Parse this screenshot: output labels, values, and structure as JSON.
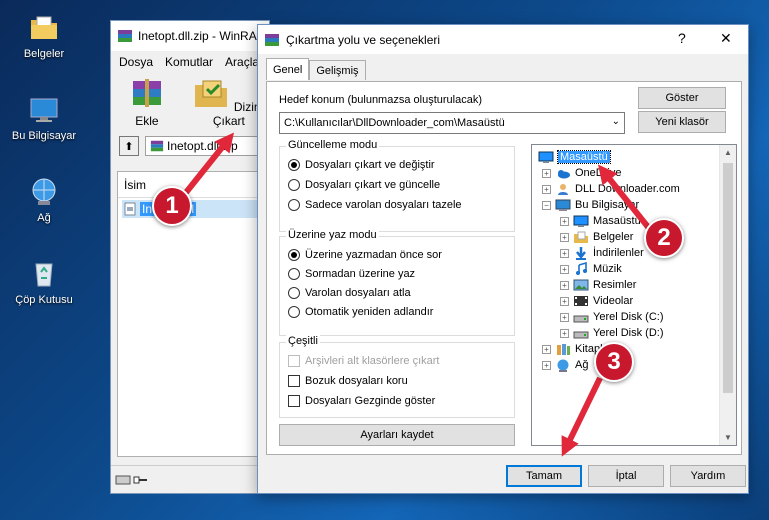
{
  "desktop": {
    "icons": [
      {
        "label": "Belgeler",
        "icon": "folder-documents-icon"
      },
      {
        "label": "Bu Bilgisayar",
        "icon": "computer-icon"
      },
      {
        "label": "Ağ",
        "icon": "network-icon"
      },
      {
        "label": "Çöp Kutusu",
        "icon": "recycle-bin-icon"
      }
    ]
  },
  "winrar": {
    "title": "Inetopt.dll.zip - WinRAR",
    "menu": [
      "Dosya",
      "Komutlar",
      "Araçlar"
    ],
    "tools": [
      {
        "label": "Ekle",
        "icon": "add-archive-icon"
      },
      {
        "label": "Dizine Çıkart",
        "icon": "extract-to-icon"
      }
    ],
    "address": "Inetopt.dll.zip",
    "column_header": "İsim",
    "selected_item": "Inetopt.dll"
  },
  "dialog": {
    "title": "Çıkartma yolu ve seçenekleri",
    "help_symbol": "?",
    "close_symbol": "✕",
    "tabs": [
      "Genel",
      "Gelişmiş"
    ],
    "destination_label": "Hedef konum (bulunmazsa oluşturulacak)",
    "destination_value": "C:\\Kullanıcılar\\DllDownloader_com\\Masaüstü",
    "show_button": "Göster",
    "new_folder_button": "Yeni klasör",
    "update_mode": {
      "title": "Güncelleme modu",
      "options": [
        "Dosyaları çıkart ve değiştir",
        "Dosyaları çıkart ve güncelle",
        "Sadece varolan dosyaları tazele"
      ],
      "selected": 0
    },
    "overwrite_mode": {
      "title": "Üzerine yaz modu",
      "options": [
        "Üzerine yazmadan önce sor",
        "Sormadan üzerine yaz",
        "Varolan dosyaları atla",
        "Otomatik yeniden adlandır"
      ],
      "selected": 0
    },
    "misc": {
      "title": "Çeşitli",
      "options": [
        {
          "label": "Arşivleri alt klasörlere çıkart",
          "checked": false,
          "disabled": true
        },
        {
          "label": "Bozuk dosyaları koru",
          "checked": false,
          "disabled": false
        },
        {
          "label": "Dosyaları Gezginde göster",
          "checked": false,
          "disabled": false
        }
      ]
    },
    "save_settings_button": "Ayarları kaydet",
    "tree": [
      {
        "label": "Masaüstü",
        "level": 0,
        "expander": "",
        "icon": "desktop-icon",
        "selected": true
      },
      {
        "label": "OneDrive",
        "level": 1,
        "expander": "+",
        "icon": "onedrive-icon",
        "selected": false
      },
      {
        "label": "DLL Downloader.com",
        "level": 1,
        "expander": "+",
        "icon": "user-folder-icon",
        "selected": false
      },
      {
        "label": "Bu Bilgisayar",
        "level": 1,
        "expander": "−",
        "icon": "computer-icon",
        "selected": false
      },
      {
        "label": "Masaüstü",
        "level": 2,
        "expander": "+",
        "icon": "desktop-icon",
        "selected": false
      },
      {
        "label": "Belgeler",
        "level": 2,
        "expander": "+",
        "icon": "documents-icon",
        "selected": false
      },
      {
        "label": "İndirilenler",
        "level": 2,
        "expander": "+",
        "icon": "downloads-icon",
        "selected": false
      },
      {
        "label": "Müzik",
        "level": 2,
        "expander": "+",
        "icon": "music-icon",
        "selected": false
      },
      {
        "label": "Resimler",
        "level": 2,
        "expander": "+",
        "icon": "pictures-icon",
        "selected": false
      },
      {
        "label": "Videolar",
        "level": 2,
        "expander": "+",
        "icon": "videos-icon",
        "selected": false
      },
      {
        "label": "Yerel Disk (C:)",
        "level": 2,
        "expander": "+",
        "icon": "drive-icon",
        "selected": false
      },
      {
        "label": "Yerel Disk (D:)",
        "level": 2,
        "expander": "+",
        "icon": "drive-icon",
        "selected": false
      },
      {
        "label": "Kitaplıklar",
        "level": 1,
        "expander": "+",
        "icon": "libraries-icon",
        "selected": false
      },
      {
        "label": "Ağ",
        "level": 1,
        "expander": "+",
        "icon": "network-icon",
        "selected": false
      }
    ],
    "ok_button": "Tamam",
    "cancel_button": "İptal",
    "help_button": "Yardım"
  },
  "annotations": {
    "badges": [
      "1",
      "2",
      "3"
    ],
    "arrow_color": "#e0283a"
  }
}
